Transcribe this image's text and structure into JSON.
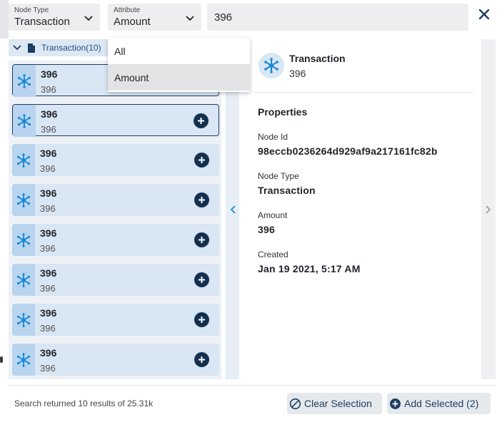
{
  "filters": {
    "node_type_label": "Node Type",
    "node_type_value": "Transaction",
    "attribute_label": "Attribute",
    "attribute_value": "Amount",
    "search_value": "396"
  },
  "dropdown": {
    "options": [
      "All",
      "Amount"
    ],
    "selected": "Amount"
  },
  "group": {
    "label": "Transaction(10)"
  },
  "results": [
    {
      "title": "396",
      "subtitle": "396"
    },
    {
      "title": "396",
      "subtitle": "396"
    },
    {
      "title": "396",
      "subtitle": "396"
    },
    {
      "title": "396",
      "subtitle": "396"
    },
    {
      "title": "396",
      "subtitle": "396"
    },
    {
      "title": "396",
      "subtitle": "396"
    },
    {
      "title": "396",
      "subtitle": "396"
    },
    {
      "title": "396",
      "subtitle": "396"
    }
  ],
  "detail": {
    "title": "Transaction",
    "subtitle": "396",
    "properties_heading": "Properties",
    "properties": [
      {
        "label": "Node Id",
        "value": "98eccb0236264d929af9a217161fc82b"
      },
      {
        "label": "Node Type",
        "value": "Transaction"
      },
      {
        "label": "Amount",
        "value": "396"
      },
      {
        "label": "Created",
        "value": "Jan 19 2021, 5:17 AM"
      }
    ]
  },
  "footer": {
    "status": "Search returned 10 results of 25.31k",
    "clear_label": "Clear Selection",
    "add_label": "Add Selected (2)"
  },
  "colors": {
    "accent": "#1d3d62",
    "node_icon": "#1c8ad8",
    "row_bg": "#d9e6f3"
  }
}
